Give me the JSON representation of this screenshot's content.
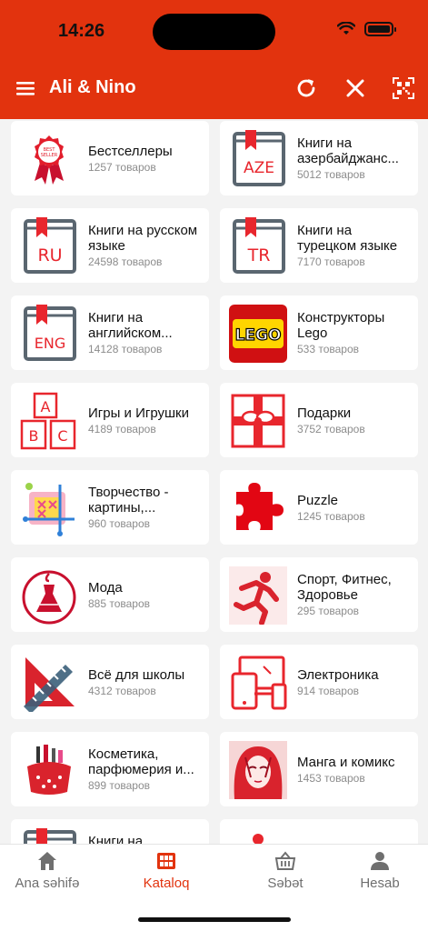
{
  "status_bar": {
    "time": "14:26"
  },
  "header": {
    "title": "Ali & Nino"
  },
  "categories": [
    {
      "title": "Бестселлеры",
      "count": "1257 товаров",
      "icon": "bestseller-badge-icon"
    },
    {
      "title": "Книги на азербайджанс...",
      "count": "5012 товаров",
      "icon": "book-aze-icon",
      "icon_text": "AZE"
    },
    {
      "title": "Книги на русском языке",
      "count": "24598 товаров",
      "icon": "book-ru-icon",
      "icon_text": "RU"
    },
    {
      "title": "Книги на турецком языке",
      "count": "7170 товаров",
      "icon": "book-tr-icon",
      "icon_text": "TR"
    },
    {
      "title": "Книги на английском...",
      "count": "14128 товаров",
      "icon": "book-eng-icon",
      "icon_text": "ENG"
    },
    {
      "title": "Конструкторы Lego",
      "count": "533 товаров",
      "icon": "lego-logo-icon",
      "icon_text": "LEGO"
    },
    {
      "title": "Игры и Игрушки",
      "count": "4189 товаров",
      "icon": "abc-blocks-icon",
      "icon_text": [
        "A",
        "B",
        "C"
      ]
    },
    {
      "title": "Подарки",
      "count": "3752 товаров",
      "icon": "gift-box-icon"
    },
    {
      "title": "Творчество - картины,...",
      "count": "960 товаров",
      "icon": "cross-stitch-icon"
    },
    {
      "title": "Puzzle",
      "count": "1245 товаров",
      "icon": "puzzle-piece-icon"
    },
    {
      "title": "Мода",
      "count": "885 товаров",
      "icon": "dress-icon"
    },
    {
      "title": "Спорт, Фитнес, Здоровье",
      "count": "295 товаров",
      "icon": "running-man-icon"
    },
    {
      "title": "Всё для школы",
      "count": "4312 товаров",
      "icon": "ruler-triangle-icon"
    },
    {
      "title": "Электроника",
      "count": "914 товаров",
      "icon": "devices-icon"
    },
    {
      "title": "Косметика, парфюмерия и...",
      "count": "899 товаров",
      "icon": "cosmetics-bag-icon"
    },
    {
      "title": "Манга и комикс",
      "count": "1453 товаров",
      "icon": "manga-girl-icon"
    },
    {
      "title": "Книги на",
      "count": "",
      "icon": "book-icon"
    },
    {
      "title": "",
      "count": "",
      "icon": "person-icon"
    }
  ],
  "tabbar": {
    "tabs": [
      {
        "label": "Ana səhifə",
        "icon": "home-icon"
      },
      {
        "label": "Kataloq",
        "icon": "catalog-icon",
        "active": true
      },
      {
        "label": "Səbət",
        "icon": "basket-icon"
      },
      {
        "label": "Hesab",
        "icon": "account-icon"
      }
    ]
  },
  "colors": {
    "brand": "#e2330e",
    "icon_gray": "#5a6670",
    "icon_red": "#e8262d"
  }
}
